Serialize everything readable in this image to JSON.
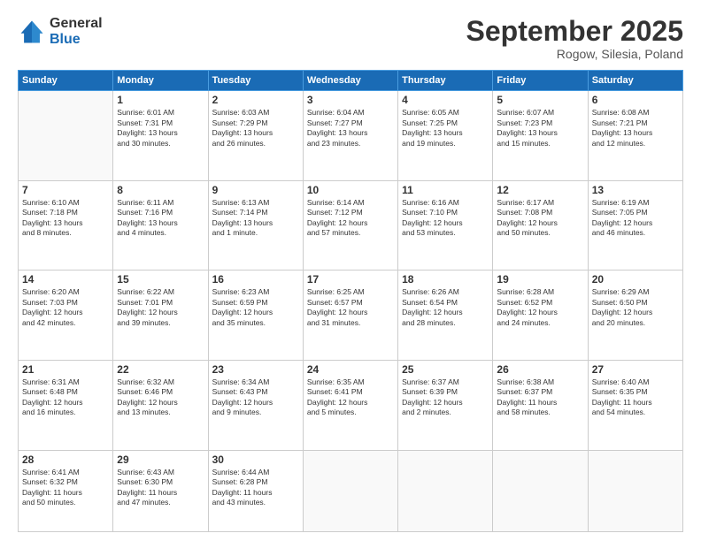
{
  "header": {
    "logo_general": "General",
    "logo_blue": "Blue",
    "month_title": "September 2025",
    "location": "Rogow, Silesia, Poland"
  },
  "days_of_week": [
    "Sunday",
    "Monday",
    "Tuesday",
    "Wednesday",
    "Thursday",
    "Friday",
    "Saturday"
  ],
  "weeks": [
    [
      {
        "day": "",
        "info": ""
      },
      {
        "day": "1",
        "info": "Sunrise: 6:01 AM\nSunset: 7:31 PM\nDaylight: 13 hours\nand 30 minutes."
      },
      {
        "day": "2",
        "info": "Sunrise: 6:03 AM\nSunset: 7:29 PM\nDaylight: 13 hours\nand 26 minutes."
      },
      {
        "day": "3",
        "info": "Sunrise: 6:04 AM\nSunset: 7:27 PM\nDaylight: 13 hours\nand 23 minutes."
      },
      {
        "day": "4",
        "info": "Sunrise: 6:05 AM\nSunset: 7:25 PM\nDaylight: 13 hours\nand 19 minutes."
      },
      {
        "day": "5",
        "info": "Sunrise: 6:07 AM\nSunset: 7:23 PM\nDaylight: 13 hours\nand 15 minutes."
      },
      {
        "day": "6",
        "info": "Sunrise: 6:08 AM\nSunset: 7:21 PM\nDaylight: 13 hours\nand 12 minutes."
      }
    ],
    [
      {
        "day": "7",
        "info": "Sunrise: 6:10 AM\nSunset: 7:18 PM\nDaylight: 13 hours\nand 8 minutes."
      },
      {
        "day": "8",
        "info": "Sunrise: 6:11 AM\nSunset: 7:16 PM\nDaylight: 13 hours\nand 4 minutes."
      },
      {
        "day": "9",
        "info": "Sunrise: 6:13 AM\nSunset: 7:14 PM\nDaylight: 13 hours\nand 1 minute."
      },
      {
        "day": "10",
        "info": "Sunrise: 6:14 AM\nSunset: 7:12 PM\nDaylight: 12 hours\nand 57 minutes."
      },
      {
        "day": "11",
        "info": "Sunrise: 6:16 AM\nSunset: 7:10 PM\nDaylight: 12 hours\nand 53 minutes."
      },
      {
        "day": "12",
        "info": "Sunrise: 6:17 AM\nSunset: 7:08 PM\nDaylight: 12 hours\nand 50 minutes."
      },
      {
        "day": "13",
        "info": "Sunrise: 6:19 AM\nSunset: 7:05 PM\nDaylight: 12 hours\nand 46 minutes."
      }
    ],
    [
      {
        "day": "14",
        "info": "Sunrise: 6:20 AM\nSunset: 7:03 PM\nDaylight: 12 hours\nand 42 minutes."
      },
      {
        "day": "15",
        "info": "Sunrise: 6:22 AM\nSunset: 7:01 PM\nDaylight: 12 hours\nand 39 minutes."
      },
      {
        "day": "16",
        "info": "Sunrise: 6:23 AM\nSunset: 6:59 PM\nDaylight: 12 hours\nand 35 minutes."
      },
      {
        "day": "17",
        "info": "Sunrise: 6:25 AM\nSunset: 6:57 PM\nDaylight: 12 hours\nand 31 minutes."
      },
      {
        "day": "18",
        "info": "Sunrise: 6:26 AM\nSunset: 6:54 PM\nDaylight: 12 hours\nand 28 minutes."
      },
      {
        "day": "19",
        "info": "Sunrise: 6:28 AM\nSunset: 6:52 PM\nDaylight: 12 hours\nand 24 minutes."
      },
      {
        "day": "20",
        "info": "Sunrise: 6:29 AM\nSunset: 6:50 PM\nDaylight: 12 hours\nand 20 minutes."
      }
    ],
    [
      {
        "day": "21",
        "info": "Sunrise: 6:31 AM\nSunset: 6:48 PM\nDaylight: 12 hours\nand 16 minutes."
      },
      {
        "day": "22",
        "info": "Sunrise: 6:32 AM\nSunset: 6:46 PM\nDaylight: 12 hours\nand 13 minutes."
      },
      {
        "day": "23",
        "info": "Sunrise: 6:34 AM\nSunset: 6:43 PM\nDaylight: 12 hours\nand 9 minutes."
      },
      {
        "day": "24",
        "info": "Sunrise: 6:35 AM\nSunset: 6:41 PM\nDaylight: 12 hours\nand 5 minutes."
      },
      {
        "day": "25",
        "info": "Sunrise: 6:37 AM\nSunset: 6:39 PM\nDaylight: 12 hours\nand 2 minutes."
      },
      {
        "day": "26",
        "info": "Sunrise: 6:38 AM\nSunset: 6:37 PM\nDaylight: 11 hours\nand 58 minutes."
      },
      {
        "day": "27",
        "info": "Sunrise: 6:40 AM\nSunset: 6:35 PM\nDaylight: 11 hours\nand 54 minutes."
      }
    ],
    [
      {
        "day": "28",
        "info": "Sunrise: 6:41 AM\nSunset: 6:32 PM\nDaylight: 11 hours\nand 50 minutes."
      },
      {
        "day": "29",
        "info": "Sunrise: 6:43 AM\nSunset: 6:30 PM\nDaylight: 11 hours\nand 47 minutes."
      },
      {
        "day": "30",
        "info": "Sunrise: 6:44 AM\nSunset: 6:28 PM\nDaylight: 11 hours\nand 43 minutes."
      },
      {
        "day": "",
        "info": ""
      },
      {
        "day": "",
        "info": ""
      },
      {
        "day": "",
        "info": ""
      },
      {
        "day": "",
        "info": ""
      }
    ]
  ]
}
